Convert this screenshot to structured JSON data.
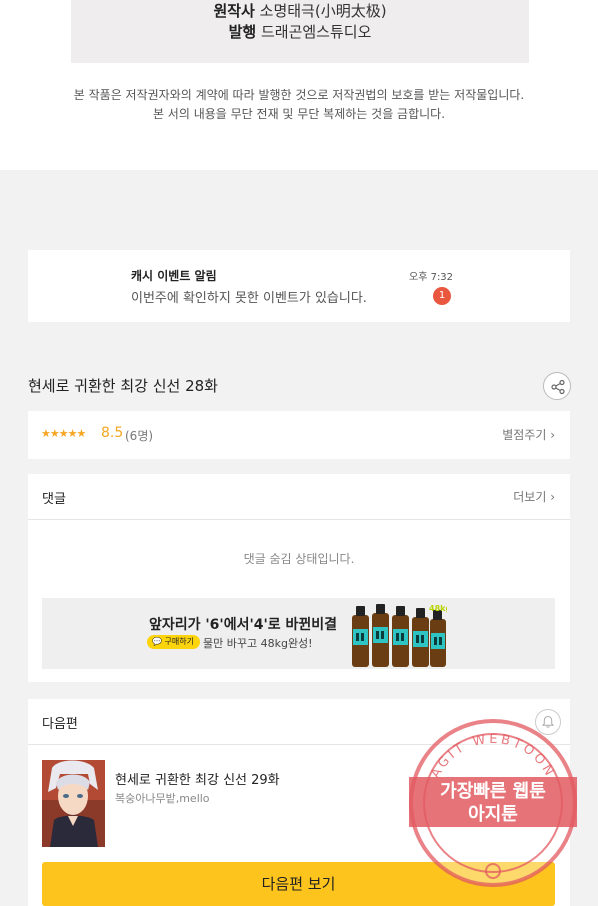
{
  "credits": {
    "original_label": "원작사",
    "original_value": "소명태극(小明太极)",
    "publisher_label": "발행",
    "publisher_value": "드래곤엠스튜디오"
  },
  "notice": {
    "line1": "본 작품은 저작권자와의 계약에 따라 발행한 것으로 저작권법의 보호를 받는 저작물입니다.",
    "line2": "본 서의 내용을 무단 전재 및 무단 복제하는 것을 금합니다."
  },
  "event": {
    "title": "캐시 이벤트 알림",
    "message": "이번주에 확인하지 못한 이벤트가 있습니다.",
    "time": "오후 7:32",
    "badge": "1"
  },
  "episode": {
    "title": "현세로 귀환한 최강 신선 28화",
    "share_icon": "share-icon"
  },
  "rating": {
    "stars": "★★★★★",
    "score": "8.5",
    "count": "(6명)",
    "link": "별점주기 ›",
    "star_color": "#f5a623"
  },
  "comments": {
    "title": "댓글",
    "more": "더보기 ›",
    "hidden_msg": "댓글 숨김 상태입니다."
  },
  "ad": {
    "headline": "앞자리가 '6'에서'4'로 바뀐비결",
    "pill": "💬 구매하기",
    "sub": "물만 바꾸고 48kg완성!",
    "bottle_label": "48kg"
  },
  "next": {
    "title": "다음편",
    "episode_title": "현세로 귀환한 최강 신선 29화",
    "authors": "복숭아나무밭,mello",
    "button": "다음편 보기",
    "button_color": "#fcc41c"
  },
  "stamp": {
    "top_text": "AGIT WEBTOON",
    "line1": "가장빠른 웹툰",
    "line2": "아지툰"
  }
}
